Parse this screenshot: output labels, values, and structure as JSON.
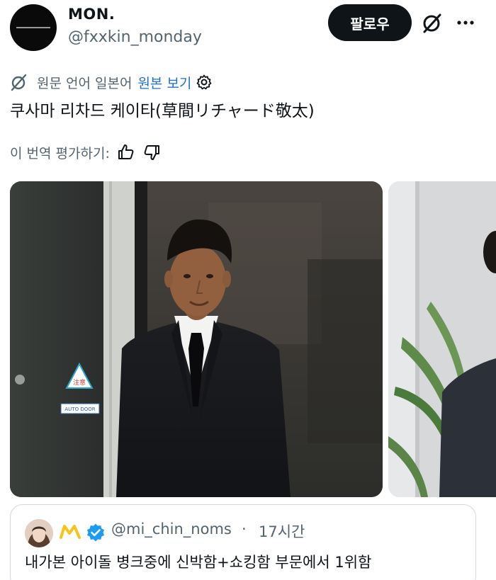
{
  "author": {
    "display_name": "MON.",
    "handle": "@fxxkin_monday",
    "follow_label": "팔로우"
  },
  "translation": {
    "source_label": "원문 언어 일본어",
    "show_original_label": "원본 보기",
    "rate_label": "이 번역 평가하기:"
  },
  "tweet": {
    "text": "쿠사마 리차드 케이타(草間リチャード敬太)"
  },
  "media": {
    "door_sign": "注意",
    "door_label": "AUTO DOOR"
  },
  "quote": {
    "handle": "@mi_chin_noms",
    "separator": "·",
    "time": "17시간",
    "text": "내가본 아이돌 병크중에 신박함+쇼킹함 부문에서 1위함"
  },
  "colors": {
    "accent_link": "#1d6fd6",
    "verified": "#1d9bf0",
    "badge_yellow": "#f5c518",
    "follow_bg": "#0f1419"
  },
  "icons": {
    "translate": "grok-translate-icon",
    "settings": "gear-icon",
    "thumbs_up": "thumbs-up-icon",
    "thumbs_down": "thumbs-down-icon",
    "more": "more-icon",
    "verified": "verified-badge-icon"
  }
}
